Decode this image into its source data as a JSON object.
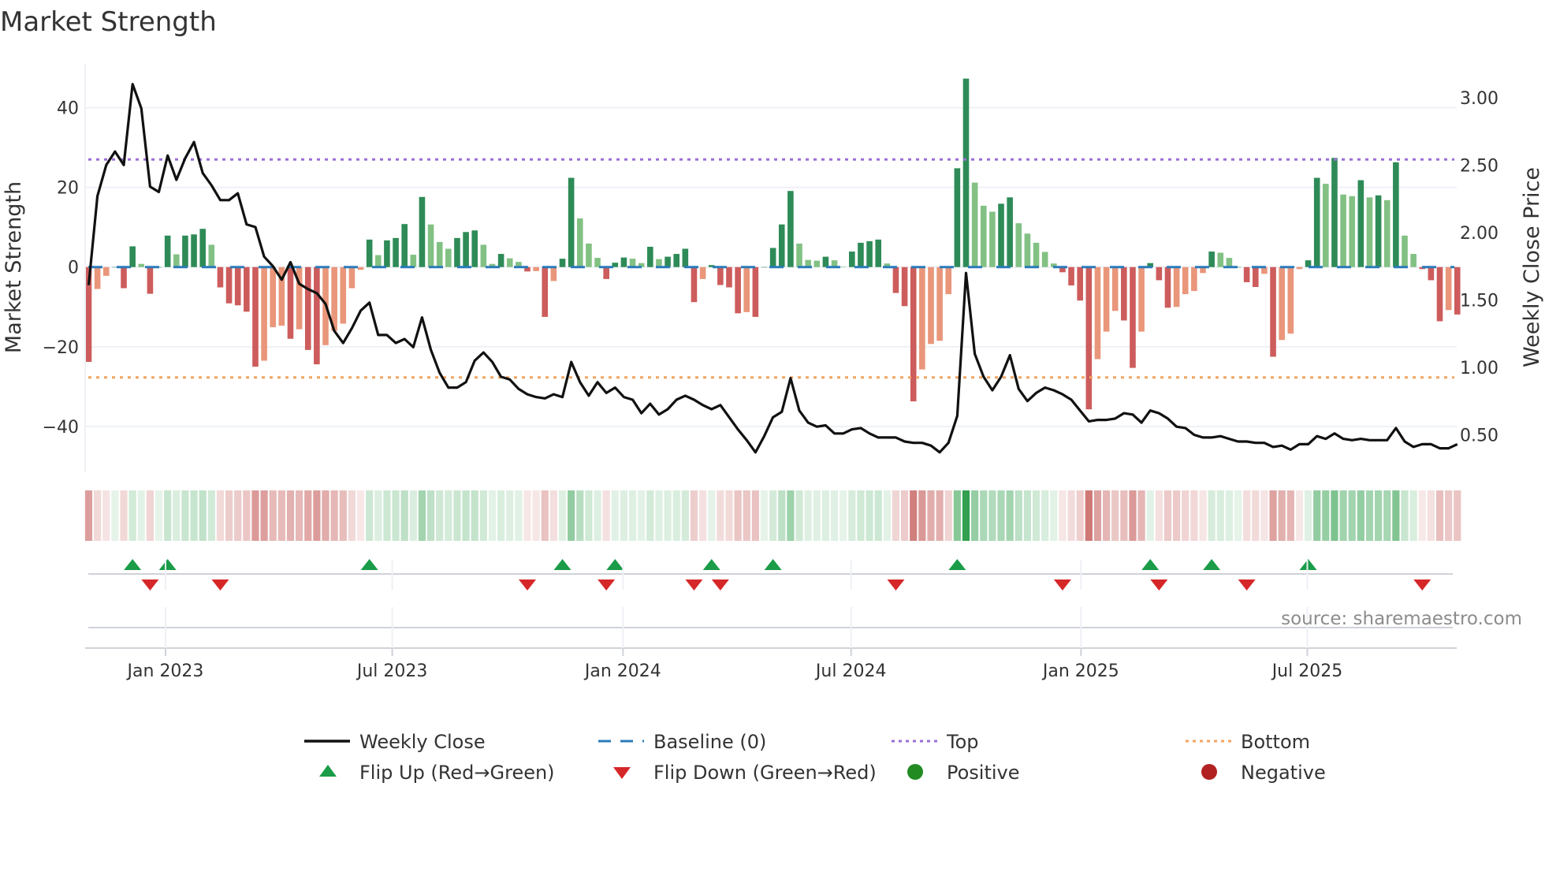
{
  "title": "Market Strength",
  "source": "source: sharemaestro.com",
  "chart_data": {
    "type": "bar",
    "title": "Market Strength",
    "ylabel": "Market Strength",
    "y2label": "Weekly Close Price",
    "xlabel": "",
    "ylim": [
      -51.3,
      51
    ],
    "y2lim": [
      0.228,
      3.25
    ],
    "yticks": [
      40,
      20,
      0,
      -20,
      -40
    ],
    "yticks_labels": [
      "40",
      "20",
      "0",
      "−20",
      "−40"
    ],
    "y2ticks": [
      3.0,
      2.5,
      2.0,
      1.5,
      1.0,
      0.5
    ],
    "y2ticks_labels": [
      "3.00",
      "2.50",
      "2.00",
      "1.50",
      "1.00",
      "0.50"
    ],
    "x_unit": "week index",
    "x_ticks": [
      {
        "label": "Jan 2023",
        "week": 9.76
      },
      {
        "label": "Jul 2023",
        "week": 35.6
      },
      {
        "label": "Jan 2024",
        "week": 61.9
      },
      {
        "label": "Jul 2024",
        "week": 87.9
      },
      {
        "label": "Jan 2025",
        "week": 114.1
      },
      {
        "label": "Jul 2025",
        "week": 139.9
      }
    ],
    "grid": true,
    "top_level": 27.0,
    "bottom_level": -27.7,
    "strength": [
      -23.8,
      -5.5,
      -2.2,
      0,
      -5.3,
      5.2,
      0.8,
      -6.7,
      0,
      7.9,
      3.2,
      7.9,
      8.2,
      9.6,
      5.6,
      -5.1,
      -9.1,
      -9.6,
      -11.2,
      -25,
      -23.5,
      -15.1,
      -14.7,
      -18,
      -15.6,
      -20.8,
      -24.4,
      -19.6,
      -16,
      -14.2,
      -5.3,
      -0.7,
      6.9,
      3.0,
      6.7,
      7.3,
      10.8,
      3.1,
      17.6,
      10.7,
      6.3,
      4.6,
      7.3,
      8.8,
      9.2,
      5.6,
      0.8,
      3.3,
      2.2,
      1.3,
      -1.1,
      -1.0,
      -12.5,
      -3.5,
      2.1,
      22.4,
      12.2,
      5.9,
      2.3,
      -3.0,
      1.1,
      2.4,
      2.1,
      1.0,
      5.1,
      2.0,
      2.6,
      3.3,
      4.6,
      -8.8,
      -3.0,
      0.5,
      -4.5,
      -5.1,
      -11.6,
      -11.3,
      -12.5,
      0,
      4.8,
      10.7,
      19.1,
      5.9,
      1.8,
      1.6,
      2.6,
      1.7,
      0.1,
      3.9,
      6.1,
      6.5,
      6.9,
      0.9,
      -6.5,
      -9.8,
      -33.7,
      -25.7,
      -19.3,
      -18.5,
      -6.8,
      24.8,
      47.3,
      21.2,
      15.4,
      13.9,
      15.9,
      17.5,
      11.0,
      8.4,
      6.1,
      3.8,
      0.9,
      -1.3,
      -4.6,
      -8.4,
      -35.7,
      -23.1,
      -16.2,
      -11.0,
      -13.4,
      -25.3,
      -16.2,
      1.0,
      -3.3,
      -10.2,
      -10.0,
      -6.8,
      -6.0,
      -1.5,
      3.9,
      3.6,
      2.3,
      0,
      -3.8,
      -5.0,
      -1.7,
      -22.5,
      -18.3,
      -16.7,
      -0.5,
      1.7,
      22.4,
      20.9,
      27.4,
      18.2,
      17.8,
      21.8,
      17.5,
      18.0,
      16.8,
      26.3,
      7.9,
      3.3,
      -0.5,
      -3.3,
      -13.6,
      -10.8,
      -11.9
    ],
    "weekly_close": [
      1.61,
      2.27,
      2.5,
      2.6,
      2.5,
      3.1,
      2.92,
      2.34,
      2.3,
      2.57,
      2.39,
      2.55,
      2.67,
      2.44,
      2.35,
      2.24,
      2.24,
      2.29,
      2.06,
      2.04,
      1.82,
      1.75,
      1.65,
      1.78,
      1.62,
      1.58,
      1.55,
      1.47,
      1.27,
      1.18,
      1.29,
      1.42,
      1.48,
      1.24,
      1.24,
      1.18,
      1.21,
      1.15,
      1.37,
      1.13,
      0.96,
      0.85,
      0.85,
      0.89,
      1.05,
      1.11,
      1.04,
      0.93,
      0.91,
      0.84,
      0.8,
      0.78,
      0.77,
      0.8,
      0.78,
      1.04,
      0.89,
      0.79,
      0.89,
      0.81,
      0.85,
      0.78,
      0.76,
      0.66,
      0.73,
      0.65,
      0.69,
      0.76,
      0.79,
      0.76,
      0.72,
      0.69,
      0.72,
      0.63,
      0.54,
      0.46,
      0.37,
      0.49,
      0.63,
      0.67,
      0.92,
      0.68,
      0.59,
      0.56,
      0.57,
      0.51,
      0.51,
      0.54,
      0.55,
      0.51,
      0.48,
      0.48,
      0.48,
      0.45,
      0.44,
      0.44,
      0.42,
      0.37,
      0.44,
      0.64,
      1.7,
      1.1,
      0.93,
      0.83,
      0.93,
      1.09,
      0.84,
      0.75,
      0.81,
      0.85,
      0.83,
      0.8,
      0.76,
      0.68,
      0.6,
      0.61,
      0.61,
      0.62,
      0.66,
      0.65,
      0.59,
      0.68,
      0.66,
      0.62,
      0.56,
      0.55,
      0.5,
      0.48,
      0.48,
      0.49,
      0.47,
      0.45,
      0.45,
      0.44,
      0.44,
      0.41,
      0.42,
      0.39,
      0.43,
      0.43,
      0.49,
      0.47,
      0.51,
      0.47,
      0.46,
      0.47,
      0.46,
      0.46,
      0.46,
      0.55,
      0.45,
      0.41,
      0.43,
      0.43,
      0.4,
      0.4,
      0.43
    ],
    "flip_up_weeks": [
      6,
      10,
      33,
      55,
      61,
      72,
      79,
      100,
      122,
      129,
      140
    ],
    "flip_down_weeks": [
      8,
      16,
      51,
      60,
      70,
      73,
      93,
      112,
      123,
      133,
      153
    ],
    "legend": {
      "placement": "bottom",
      "items": [
        {
          "label": "Weekly Close",
          "kind": "line"
        },
        {
          "label": "Baseline (0)",
          "kind": "dashed"
        },
        {
          "label": "Top",
          "kind": "dotted-top"
        },
        {
          "label": "Bottom",
          "kind": "dotted-bottom"
        },
        {
          "label": "Flip Up (Red→Green)",
          "kind": "tri-up"
        },
        {
          "label": "Flip Down (Green→Red)",
          "kind": "tri-down"
        },
        {
          "label": "Positive",
          "kind": "dot-pos"
        },
        {
          "label": "Negative",
          "kind": "dot-neg"
        }
      ]
    },
    "colors": {
      "pos_strong": "#2e8b57",
      "pos_weak": "#82c183",
      "neg_strong": "#cd5c5c",
      "neg_weak": "#e9967a",
      "line": "#111111",
      "baseline": "#2b7bba",
      "top": "#9b6fd6",
      "bottom": "#f4a460",
      "flip_up": "#1a9c48",
      "flip_down": "#d62728",
      "dot_pos": "#228b22",
      "dot_neg": "#b22222",
      "strip_pos": "#2e9e4a",
      "strip_neg": "#c0504d"
    }
  }
}
